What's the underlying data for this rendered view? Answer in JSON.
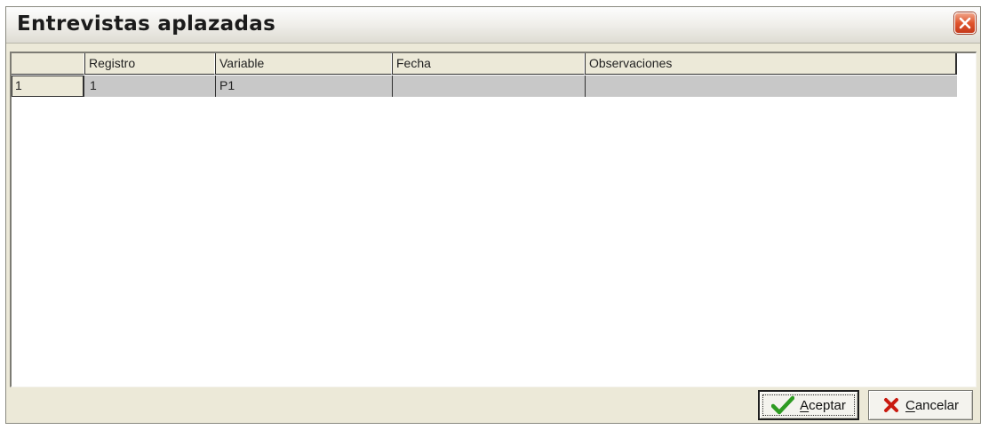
{
  "window": {
    "title": "Entrevistas aplazadas"
  },
  "grid": {
    "columns": [
      "",
      "Registro",
      "Variable",
      "Fecha",
      "Observaciones"
    ],
    "rows": [
      {
        "row_number": "1",
        "registro": "1",
        "variable": "P1",
        "fecha": "",
        "observaciones": ""
      }
    ]
  },
  "footer": {
    "accept_accel": "A",
    "accept_rest": "ceptar",
    "cancel_accel": "C",
    "cancel_rest": "ancelar"
  },
  "colors": {
    "accept_check": "#2e9b22",
    "cancel_x": "#c91a10",
    "selected_row": "#c8c8c8"
  }
}
